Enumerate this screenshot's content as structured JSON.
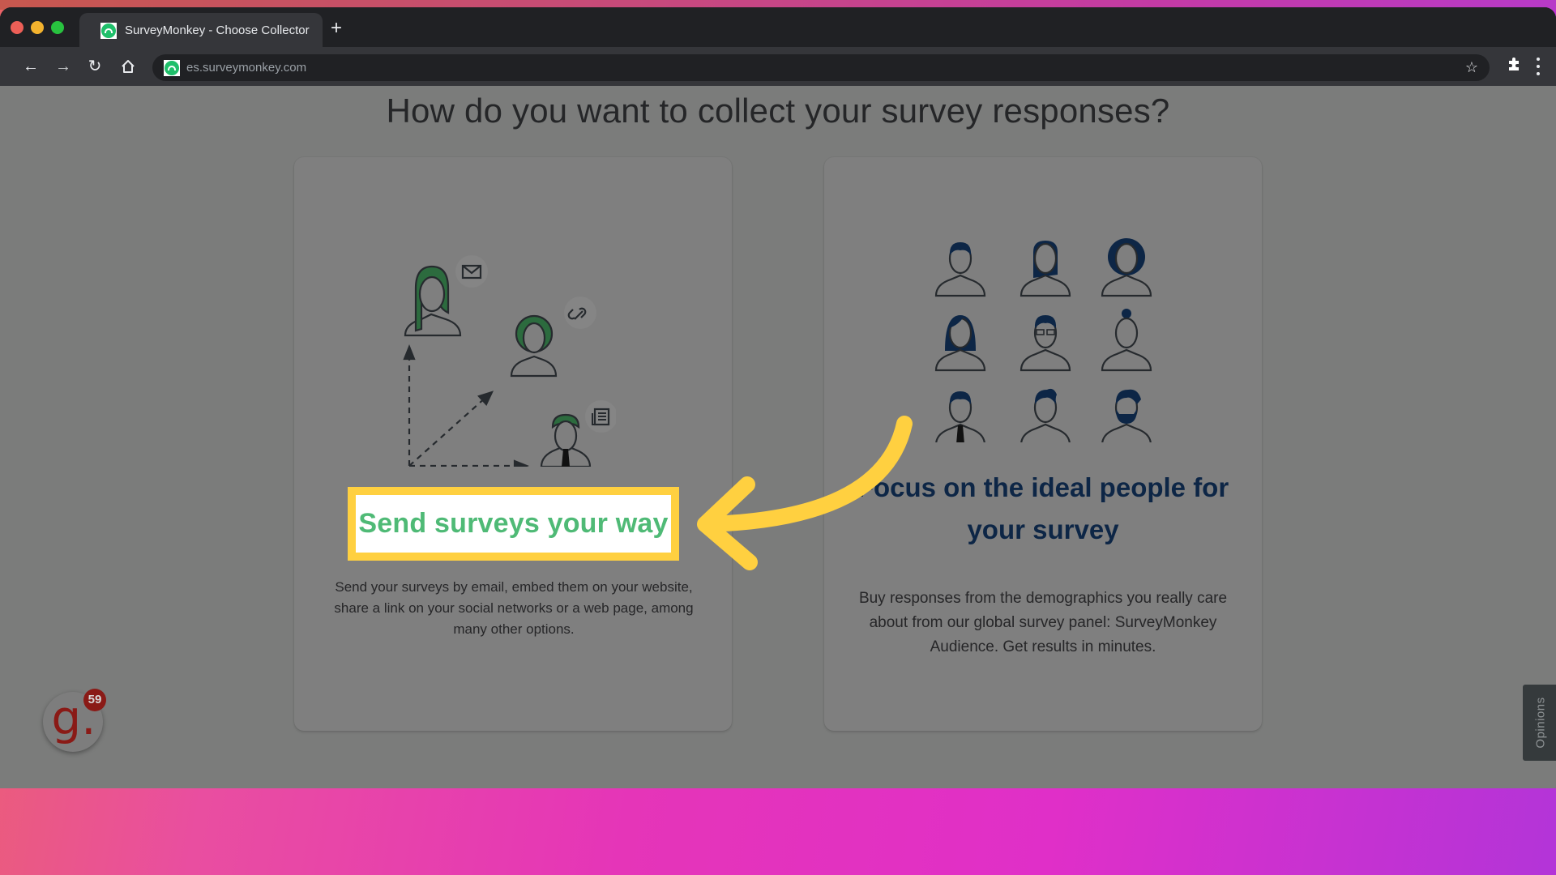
{
  "browser": {
    "tab_title": "SurveyMonkey - Choose Collector",
    "tab_favicon": "surveymonkey-logo",
    "new_tab_label": "+",
    "url": "es.surveymonkey.com",
    "nav_icons": {
      "back": "←",
      "forward": "→",
      "reload": "↻",
      "home": "⌂",
      "bookmark": "☆",
      "extensions": "✱"
    }
  },
  "page": {
    "title": "How do you want to collect your survey responses?",
    "options": [
      {
        "id": "send-surveys",
        "title": "Send surveys your way",
        "description": "Send your surveys by email, embed them on your website, share a link on your social networks or a web page, among many other options.",
        "accent_color": "#4fba76",
        "channel_icons": [
          "email-icon",
          "link-icon",
          "newspaper-icon"
        ]
      },
      {
        "id": "audience",
        "title": "Focus on the ideal people for your survey",
        "description": "Buy responses from the demographics you really care about from our global survey panel: SurveyMonkey Audience. Get results in minutes.",
        "accent_color": "#0d2646"
      }
    ]
  },
  "annotation": {
    "highlight_color": "#ffd040",
    "arrow_color": "#ffd040"
  },
  "widgets": {
    "g_badge_letter": "g.",
    "g_badge_count": "59",
    "opinions_label": "Opinions"
  }
}
